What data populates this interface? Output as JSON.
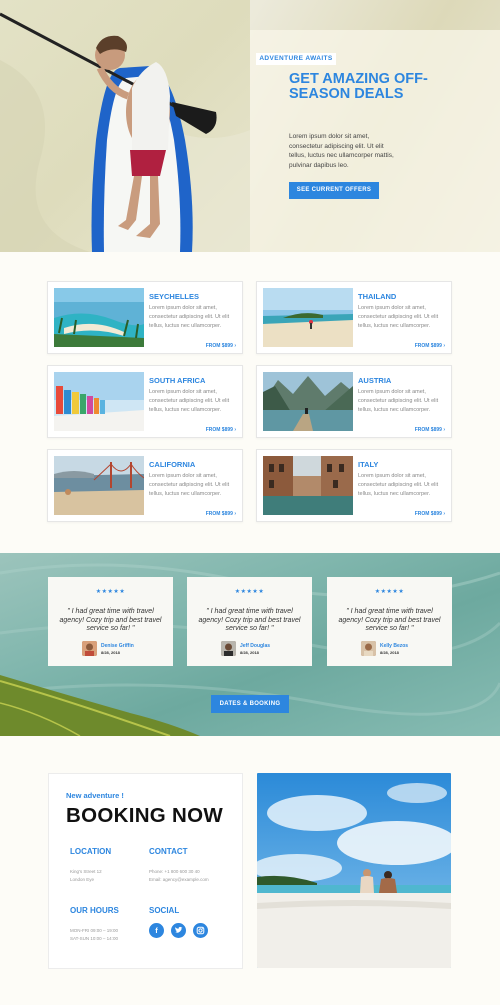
{
  "hero": {
    "eyebrow": "ADVENTURE AWAITS",
    "title": "GET AMAZING OFF-SEASON DEALS",
    "text": "Lorem ipsum dolor sit amet, consectetur adipiscing elit. Ut elit tellus, luctus nec ullamcorper mattis, pulvinar dapibus leo.",
    "cta": "SEE CURRENT OFFERS"
  },
  "destinations": [
    {
      "name": "SEYCHELLES",
      "desc": "Lorem ipsum dolor sit amet, consectetur adipiscing elit. Ut elit tellus, luctus nec ullamcorper.",
      "price": "FROM $899 ›"
    },
    {
      "name": "THAILAND",
      "desc": "Lorem ipsum dolor sit amet, consectetur adipiscing elit. Ut elit tellus, luctus nec ullamcorper.",
      "price": "FROM $899 ›"
    },
    {
      "name": "SOUTH AFRICA",
      "desc": "Lorem ipsum dolor sit amet, consectetur adipiscing elit. Ut elit tellus, luctus nec ullamcorper.",
      "price": "FROM $899 ›"
    },
    {
      "name": "AUSTRIA",
      "desc": "Lorem ipsum dolor sit amet, consectetur adipiscing elit. Ut elit tellus, luctus nec ullamcorper.",
      "price": "FROM $899 ›"
    },
    {
      "name": "CALIFORNIA",
      "desc": "Lorem ipsum dolor sit amet, consectetur adipiscing elit. Ut elit tellus, luctus nec ullamcorper.",
      "price": "FROM $899 ›"
    },
    {
      "name": "ITALY",
      "desc": "Lorem ipsum dolor sit amet, consectetur adipiscing elit. Ut elit tellus, luctus nec ullamcorper.",
      "price": "FROM $899 ›"
    }
  ],
  "testimonials": [
    {
      "stars": "★★★★★",
      "quote": "\" I had great time with travel agency! Cozy trip and best travel service so far! \"",
      "name": "Denise Griffin",
      "date": "8/28, 2018"
    },
    {
      "stars": "★★★★★",
      "quote": "\" I had great time with travel agency! Cozy trip and best travel service so far! \"",
      "name": "Jeff Douglas",
      "date": "8/28, 2018"
    },
    {
      "stars": "★★★★★",
      "quote": "\" I had great time with travel agency! Cozy trip and best travel service so far! \"",
      "name": "Kelly Bezos",
      "date": "8/28, 2018"
    }
  ],
  "booking_button": "DATES & BOOKING",
  "booking": {
    "subtitle": "New adventure !",
    "title": "BOOKING NOW",
    "location_heading": "LOCATION",
    "location_line1": "King's Street 12",
    "location_line2": "London Eye",
    "contact_heading": "CONTACT",
    "contact_line1": "Phone: +1 800 600 30 40",
    "contact_line2": "Email: agency@example.com",
    "hours_heading": "OUR HOURS",
    "hours_line1": "MON-FRI 09:00 – 19:00",
    "hours_line2": "SAT-SUN 10:00 – 14:00",
    "social_heading": "SOCIAL",
    "icons": [
      "facebook-icon",
      "twitter-icon",
      "instagram-icon"
    ]
  },
  "colors": {
    "accent": "#2d86df",
    "background": "#fdfcf7",
    "heading": "#111111"
  }
}
